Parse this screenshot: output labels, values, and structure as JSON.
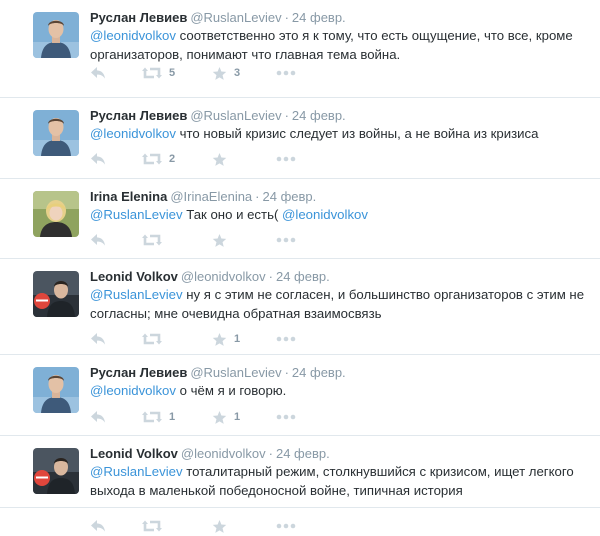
{
  "tweets": [
    {
      "fullname": "Руслан Левиев",
      "username": "@RuslanLeviev",
      "sep": "·",
      "time": "24 февр.",
      "text_parts": [
        {
          "t": "@leonidvolkov",
          "mention": true
        },
        {
          "t": " соответственно это я к тому, что есть ощущение, что все, кроме организаторов, понимают что главная тема война.",
          "mention": false
        }
      ],
      "retweet_count": "5",
      "favorite_count": "3",
      "avatar": "ruslan"
    },
    {
      "fullname": "Руслан Левиев",
      "username": "@RuslanLeviev",
      "sep": "·",
      "time": "24 февр.",
      "text_parts": [
        {
          "t": "@leonidvolkov",
          "mention": true
        },
        {
          "t": " что новый кризис следует из войны, а не война из кризиса",
          "mention": false
        }
      ],
      "retweet_count": "2",
      "favorite_count": "",
      "avatar": "ruslan"
    },
    {
      "fullname": "Irina Elenina",
      "username": "@IrinaElenina",
      "sep": "·",
      "time": "24 февр.",
      "text_parts": [
        {
          "t": "@RuslanLeviev",
          "mention": true
        },
        {
          "t": " Так оно и есть( ",
          "mention": false
        },
        {
          "t": "@leonidvolkov",
          "mention": true
        }
      ],
      "retweet_count": "",
      "favorite_count": "",
      "avatar": "irina"
    },
    {
      "fullname": "Leonid Volkov",
      "username": "@leonidvolkov",
      "sep": "·",
      "time": "24 февр.",
      "text_parts": [
        {
          "t": "@RuslanLeviev",
          "mention": true
        },
        {
          "t": " ну я с этим не согласен, и большинство организаторов с этим не согласны; мне очевидна обратная взаимосвязь",
          "mention": false
        }
      ],
      "retweet_count": "",
      "favorite_count": "1",
      "avatar": "leonid"
    },
    {
      "fullname": "Руслан Левиев",
      "username": "@RuslanLeviev",
      "sep": "·",
      "time": "24 февр.",
      "text_parts": [
        {
          "t": "@leonidvolkov",
          "mention": true
        },
        {
          "t": " о чём я и говорю.",
          "mention": false
        }
      ],
      "retweet_count": "1",
      "favorite_count": "1",
      "avatar": "ruslan"
    },
    {
      "fullname": "Leonid Volkov",
      "username": "@leonidvolkov",
      "sep": "·",
      "time": "24 февр.",
      "text_parts": [
        {
          "t": "@RuslanLeviev",
          "mention": true
        },
        {
          "t": " тоталитарный режим, столкнувшийся с кризисом, ищет легкого выхода в маленькой победоносной войне, типичная история",
          "mention": false
        }
      ],
      "retweet_count": "",
      "favorite_count": "",
      "avatar": "leonid"
    }
  ],
  "icons": {
    "reply": "reply-icon",
    "retweet": "retweet-icon",
    "favorite": "star-icon",
    "more": "more-icon"
  },
  "colors": {
    "mention": "#3b94d9",
    "meta": "#8899a6",
    "action_icon": "#ccd6dd",
    "divider": "#e1e8ed"
  }
}
